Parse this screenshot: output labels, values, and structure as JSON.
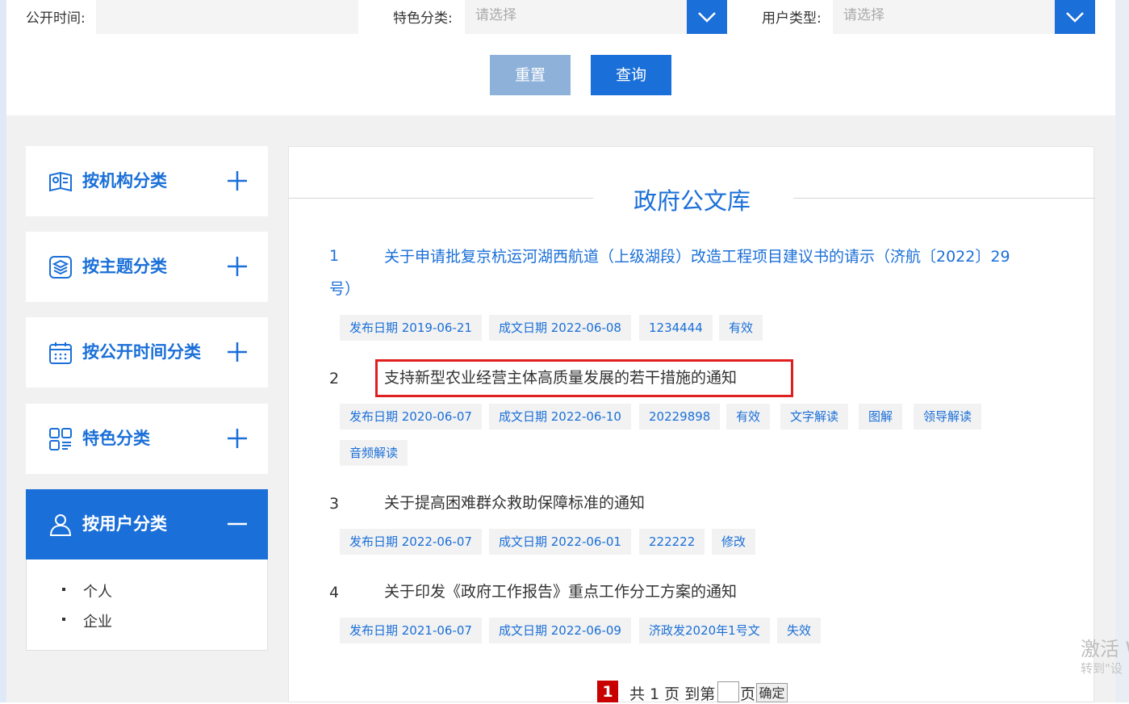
{
  "filters": {
    "date_label": "公开时间:",
    "feature_label": "特色分类:",
    "feature_placeholder": "请选择",
    "user_label": "用户类型:",
    "user_placeholder": "请选择"
  },
  "buttons": {
    "reset": "重置",
    "query": "查询"
  },
  "sidebar": {
    "items": [
      {
        "label": "按机构分类",
        "icon": "institution-icon",
        "expander": "+"
      },
      {
        "label": "按主题分类",
        "icon": "layers-icon",
        "expander": "+"
      },
      {
        "label": "按公开时间分类",
        "icon": "calendar-icon",
        "expander": "+"
      },
      {
        "label": "特色分类",
        "icon": "grid-icon",
        "expander": "+"
      },
      {
        "label": "按用户分类",
        "icon": "user-icon",
        "expander": "−"
      }
    ],
    "sub_items": [
      "个人",
      "企业"
    ]
  },
  "main": {
    "title": "政府公文库",
    "docs": [
      {
        "num": "1",
        "title_line1": "关于申请批复京杭运河湖西航道（上级湖段）改造工程项目建议书的请示（济航〔2022〕29",
        "title_line2": "号）",
        "tags": [
          "发布日期 2019-06-21",
          "成文日期 2022-06-08",
          "1234444",
          "有效"
        ]
      },
      {
        "num": "2",
        "title": "支持新型农业经营主体高质量发展的若干措施的通知",
        "tags": [
          "发布日期 2020-06-07",
          "成文日期 2022-06-10",
          "20229898",
          "有效",
          "文字解读",
          "图解",
          "领导解读",
          "音频解读"
        ]
      },
      {
        "num": "3",
        "title": "关于提高困难群众救助保障标准的通知",
        "tags": [
          "发布日期 2022-06-07",
          "成文日期 2022-06-01",
          "222222",
          "修改"
        ]
      },
      {
        "num": "4",
        "title": "关于印发《政府工作报告》重点工作分工方案的通知",
        "tags": [
          "发布日期 2021-06-07",
          "成文日期 2022-06-09",
          "济政发2020年1号文",
          "失效"
        ]
      }
    ]
  },
  "pager": {
    "current": "1",
    "total_text": "共 1 页 到第",
    "page_suffix": "页",
    "confirm": "确定"
  },
  "watermark": {
    "line1": "激活 W",
    "line2": "转到\"设"
  },
  "colors": {
    "accent": "#1a6fd8",
    "highlight": "#e02020",
    "current_page": "#c80000"
  }
}
